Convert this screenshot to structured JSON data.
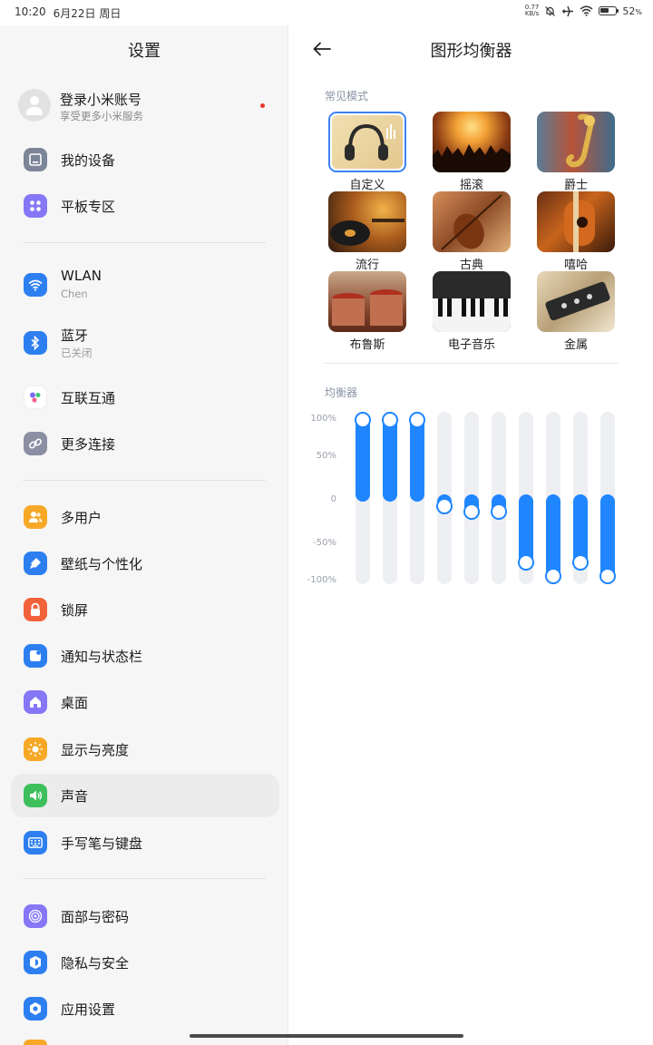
{
  "status": {
    "time": "10:20",
    "date": "6月22日 周日",
    "net_speed_value": "0.77",
    "net_speed_unit": "KB/s",
    "battery": "52",
    "battery_unit": "%"
  },
  "left": {
    "title": "设置",
    "account": {
      "title": "登录小米账号",
      "subtitle": "享受更多小米服务"
    },
    "items": [
      {
        "label": "我的设备",
        "icon": "device-icon",
        "color": "#7d8599"
      },
      {
        "label": "平板专区",
        "icon": "apps-grid-icon",
        "color": "#8577f5"
      },
      {
        "label": "WLAN",
        "sub": "Chen",
        "icon": "wifi-icon",
        "color": "#2d7ff0"
      },
      {
        "label": "蓝牙",
        "sub": "已关闭",
        "icon": "bluetooth-icon",
        "color": "#2d7ff0"
      },
      {
        "label": "互联互通",
        "icon": "interconnect-icon",
        "color": "#ffffff"
      },
      {
        "label": "更多连接",
        "icon": "link-icon",
        "color": "#8a8fa3"
      },
      {
        "label": "多用户",
        "icon": "users-icon",
        "color": "#f7a826"
      },
      {
        "label": "壁纸与个性化",
        "icon": "brush-icon",
        "color": "#2d7ff0"
      },
      {
        "label": "锁屏",
        "icon": "lock-icon",
        "color": "#f2623a"
      },
      {
        "label": "通知与状态栏",
        "icon": "notification-icon",
        "color": "#2d7ff0"
      },
      {
        "label": "桌面",
        "icon": "home-icon",
        "color": "#8577f5"
      },
      {
        "label": "显示与亮度",
        "icon": "brightness-icon",
        "color": "#f7a826"
      },
      {
        "label": "声音",
        "icon": "speaker-icon",
        "color": "#3dc05c"
      },
      {
        "label": "手写笔与键盘",
        "icon": "keyboard-icon",
        "color": "#2d7ff0"
      },
      {
        "label": "面部与密码",
        "icon": "face-lock-icon",
        "color": "#8577f5"
      },
      {
        "label": "隐私与安全",
        "icon": "privacy-shield-icon",
        "color": "#2d7ff0"
      },
      {
        "label": "应用设置",
        "icon": "app-settings-icon",
        "color": "#2d7ff0"
      }
    ]
  },
  "right": {
    "title": "图形均衡器",
    "modes_label": "常见模式",
    "modes": [
      {
        "label": "自定义",
        "selected": true
      },
      {
        "label": "摇滚"
      },
      {
        "label": "爵士"
      },
      {
        "label": "流行"
      },
      {
        "label": "古典"
      },
      {
        "label": "嘻哈"
      },
      {
        "label": "布鲁斯"
      },
      {
        "label": "电子音乐"
      },
      {
        "label": "金属"
      }
    ],
    "eq_label": "均衡器",
    "y_ticks": [
      "100%",
      "50%",
      "0",
      "-50%",
      "-100%"
    ],
    "bands_percent": [
      100,
      100,
      100,
      -10,
      -18,
      -18,
      -82,
      -100,
      -82,
      -100
    ]
  }
}
